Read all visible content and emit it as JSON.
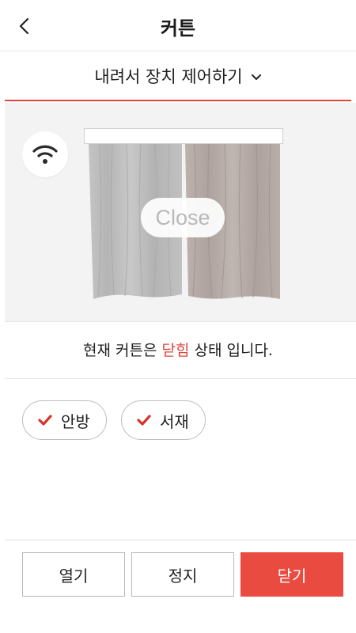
{
  "header": {
    "title": "커튼",
    "back_icon": "chevron-left-icon"
  },
  "selector": {
    "label": "내려서 장치 제어하기",
    "icon": "chevron-down-icon"
  },
  "device": {
    "wifi_icon": "wifi-icon",
    "state_label": "Close"
  },
  "status": {
    "prefix": "현재 커튼은 ",
    "highlight": "닫힘",
    "suffix": " 상태 입니다.",
    "highlight_color": "#e0453b"
  },
  "rooms": [
    {
      "label": "안방",
      "checked": true
    },
    {
      "label": "서재",
      "checked": true
    }
  ],
  "actions": {
    "open": "열기",
    "stop": "정지",
    "close": "닫기"
  },
  "colors": {
    "accent": "#e94b40"
  }
}
